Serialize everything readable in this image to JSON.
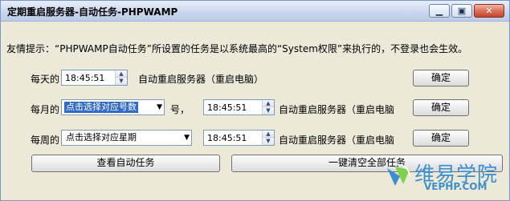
{
  "window": {
    "title": "定期重启服务器-自动任务-PHPWAMP",
    "minimize_icon": "minimize-icon",
    "maximize_icon": "maximize-icon",
    "close_icon": "close-icon"
  },
  "tip": "友情提示：“PHPWAMP自动任务”所设置的任务是以系统最高的“System权限”来执行的，不登录也会生效。",
  "daily": {
    "label": "每天的",
    "time": "18:45:51",
    "action": "自动重启服务器（重启电脑）",
    "confirm": "确定"
  },
  "monthly": {
    "label": "每月的",
    "day_select": "点击选择对应号数",
    "day_suffix": "号，",
    "time": "18:45:51",
    "action": "自动重启服务器（重启电脑",
    "confirm": "确定"
  },
  "weekly": {
    "label": "每周的",
    "weekday_select": "点击选择对应星期",
    "time": "18:45:51",
    "action": "自动重启服务器（重启电脑",
    "confirm": "确定"
  },
  "buttons": {
    "view_tasks": "查看自动任务",
    "clear_all": "一键清空全部任务"
  },
  "watermark": {
    "cn": "维易学院",
    "en": "VEPHP.COM"
  },
  "colors": {
    "selection": "#316ac5",
    "watermark": "#3b8fd0"
  }
}
